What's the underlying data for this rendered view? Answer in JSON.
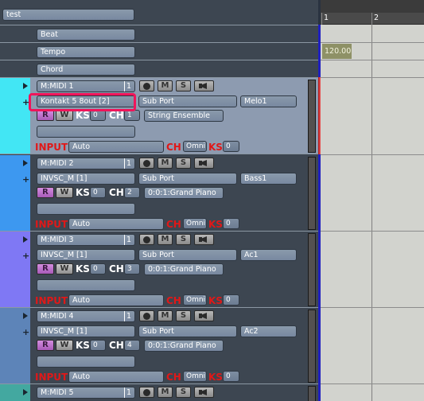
{
  "folder": {
    "name": "test"
  },
  "global_tracks": [
    {
      "label": "Beat"
    },
    {
      "label": "Tempo"
    },
    {
      "label": "Chord"
    }
  ],
  "tracks": [
    {
      "name": "M:MIDI 1",
      "index": "1",
      "port": "Kontakt 5 8out [2]",
      "sub_port": "Sub Port",
      "label": "Melo1",
      "ks": "0",
      "ch": "1",
      "instrument": "String Ensemble",
      "input": "Auto",
      "in_ch": "Omni",
      "in_ks": "0",
      "color": "#42e6f4",
      "selected": true
    },
    {
      "name": "M:MIDI 2",
      "index": "1",
      "port": "INVSC_M [1]",
      "sub_port": "Sub Port",
      "label": "Bass1",
      "ks": "0",
      "ch": "2",
      "instrument": "0:0:1:Grand Piano",
      "input": "Auto",
      "in_ch": "Omni",
      "in_ks": "0",
      "color": "#3d98f0",
      "selected": false
    },
    {
      "name": "M:MIDI 3",
      "index": "1",
      "port": "INVSC_M [1]",
      "sub_port": "Sub Port",
      "label": "Ac1",
      "ks": "0",
      "ch": "3",
      "instrument": "0:0:1:Grand Piano",
      "input": "Auto",
      "in_ch": "Omni",
      "in_ks": "0",
      "color": "#7f78f4",
      "selected": false
    },
    {
      "name": "M:MIDI 4",
      "index": "1",
      "port": "INVSC_M [1]",
      "sub_port": "Sub Port",
      "label": "Ac2",
      "ks": "0",
      "ch": "4",
      "instrument": "0:0:1:Grand Piano",
      "input": "Auto",
      "in_ch": "Omni",
      "in_ks": "0",
      "color": "#5d84b8",
      "selected": false
    },
    {
      "name": "M:MIDI 5",
      "index": "1",
      "color": "#43a8a0",
      "selected": false
    }
  ],
  "labels": {
    "record": "",
    "mute": "M",
    "solo": "S",
    "monitor": "",
    "read": "R",
    "write": "W",
    "ks": "KS",
    "ch": "CH",
    "input": "INPUT"
  },
  "ruler": {
    "bars": [
      "1",
      "2"
    ]
  },
  "tempo_event": {
    "value": "120.00"
  },
  "colors": {
    "highlight": "#f0145a",
    "input_label": "#e01818",
    "grid_bg": "#d2d3ce",
    "tempo_event": "#8e9166"
  }
}
